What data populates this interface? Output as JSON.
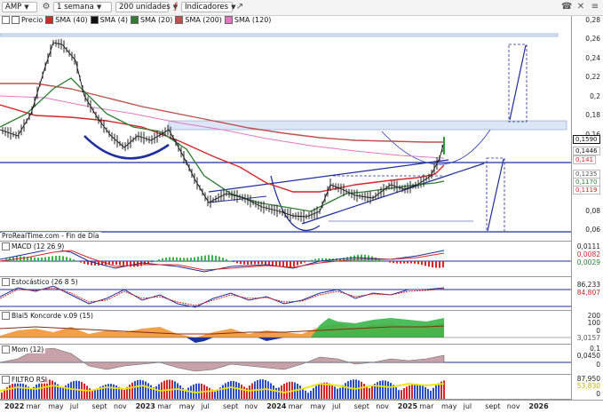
{
  "toolbar": {
    "symbol": "AMP",
    "period": "1 semana",
    "units": "200 unidades",
    "indicators": "Indicadores"
  },
  "legend": [
    {
      "label": "Precio",
      "color": "#ffffff"
    },
    {
      "label": "SMA (40)",
      "color": "#d62728"
    },
    {
      "label": "SMA (4)",
      "color": "#111111"
    },
    {
      "label": "SMA (20)",
      "color": "#2e7d32"
    },
    {
      "label": "SMA (200)",
      "color": "#c0504d"
    },
    {
      "label": "SMA (120)",
      "color": "#e377c2"
    }
  ],
  "source_text": "ProRealTime.com - Fin de Día",
  "price_axis": {
    "ticks": [
      "0,28",
      "0,26",
      "0,24",
      "0,22",
      "0,2",
      "0,18",
      "0,16",
      "0,14",
      "0,12",
      "0,1",
      "0,08",
      "0,06"
    ],
    "labels": [
      {
        "text": "0,1590",
        "color": "#111111"
      },
      {
        "text": "0,1446",
        "color": "#111111"
      },
      {
        "text": "0,141",
        "color": "#d62728"
      },
      {
        "text": "0,1235",
        "color": "#555555"
      },
      {
        "text": "0,1170",
        "color": "#2e7d32"
      },
      {
        "text": "0,1119",
        "color": "#d62728"
      }
    ]
  },
  "panels": {
    "macd": {
      "title": "MACD (12 26 9)",
      "ticks": [
        "0,0111",
        "0,0082",
        "0,0029"
      ]
    },
    "stoch": {
      "title": "Estocástico (26 8 5)",
      "ticks": [
        "86,233",
        "84,807"
      ]
    },
    "koncorde": {
      "title": "Blai5 Koncorde v.09 (15)",
      "ticks": [
        "200",
        "100",
        "0",
        "3,0157"
      ]
    },
    "mom": {
      "title": "Mom (12)",
      "ticks": [
        "0,1",
        "0,0450",
        "0"
      ]
    },
    "rsi": {
      "title": "FILTRO RSI",
      "ticks": [
        "87,950",
        "53,830",
        "0"
      ]
    }
  },
  "x_axis": [
    "2022",
    "mar",
    "may",
    "jul",
    "sept",
    "nov",
    "2023",
    "mar",
    "may",
    "jul",
    "sept",
    "nov",
    "2024",
    "mar",
    "may",
    "jul",
    "sept",
    "nov",
    "2025",
    "mar",
    "may",
    "jul",
    "sept",
    "nov",
    "2026"
  ],
  "chart_data": {
    "type": "line",
    "title": "AMP",
    "x": [
      "2022",
      "may",
      "jul",
      "sept",
      "nov",
      "2023",
      "mar",
      "may",
      "jul",
      "sept",
      "nov",
      "2024",
      "mar",
      "may",
      "jul",
      "sept",
      "nov",
      "2025",
      "mar"
    ],
    "series": [
      {
        "name": "Precio",
        "values": [
          0.145,
          0.262,
          0.215,
          0.165,
          0.155,
          0.16,
          0.15,
          0.1,
          0.105,
          0.098,
          0.085,
          0.072,
          0.08,
          0.115,
          0.105,
          0.11,
          0.108,
          0.115,
          0.159
        ]
      },
      {
        "name": "SMA (40)",
        "values": [
          0.21,
          0.205,
          0.195,
          0.185,
          0.177,
          0.17,
          0.16,
          0.15,
          0.14,
          0.13,
          0.12,
          0.11,
          0.103,
          0.1,
          0.102,
          0.105,
          0.108,
          0.11,
          0.1119
        ]
      },
      {
        "name": "SMA (200)",
        "values": [
          0.2,
          0.199,
          0.197,
          0.192,
          0.187,
          0.183,
          0.179,
          0.174,
          0.168,
          0.162,
          0.157,
          0.152,
          0.148,
          0.146,
          0.144,
          0.143,
          0.142,
          0.1415,
          0.141
        ]
      }
    ],
    "ylim": [
      0.06,
      0.28
    ]
  }
}
